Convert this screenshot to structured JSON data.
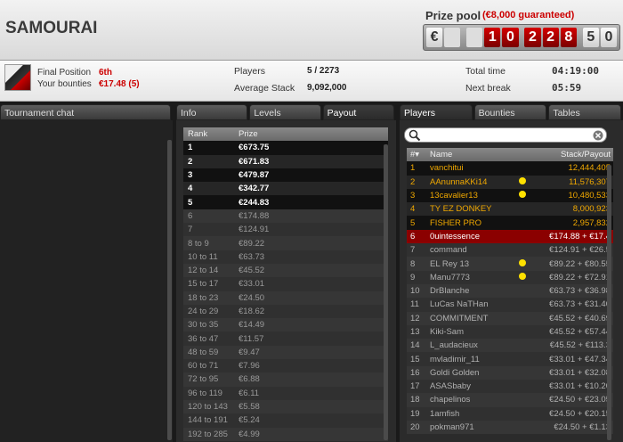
{
  "title": "SAMOURAI",
  "prize_pool": {
    "label": "Prize pool",
    "guarantee": "(€8,000 guaranteed)",
    "currency": "€",
    "digits": [
      "1",
      "0",
      "2",
      "2",
      "8",
      "5",
      "0"
    ]
  },
  "me": {
    "final_position_label": "Final Position",
    "final_position": "6th",
    "bounties_label": "Your bounties",
    "bounties": "€17.48 (5)"
  },
  "stats": {
    "players_label": "Players",
    "players": "5 / 2273",
    "avg_label": "Average Stack",
    "avg": "9,092,000",
    "time_label": "Total time",
    "time": "04:19:00",
    "break_label": "Next break",
    "break": "05:59"
  },
  "chat": {
    "tab": "Tournament chat"
  },
  "mid_tabs": [
    "Info",
    "Levels",
    "Payout"
  ],
  "right_tabs": [
    "Players",
    "Bounties",
    "Tables"
  ],
  "payout": {
    "headers": [
      "Rank",
      "Prize"
    ],
    "rows": [
      [
        "1",
        "€673.75"
      ],
      [
        "2",
        "€671.83"
      ],
      [
        "3",
        "€479.87"
      ],
      [
        "4",
        "€342.77"
      ],
      [
        "5",
        "€244.83"
      ],
      [
        "6",
        "€174.88"
      ],
      [
        "7",
        "€124.91"
      ],
      [
        "8 to 9",
        "€89.22"
      ],
      [
        "10 to 11",
        "€63.73"
      ],
      [
        "12 to 14",
        "€45.52"
      ],
      [
        "15 to 17",
        "€33.01"
      ],
      [
        "18 to 23",
        "€24.50"
      ],
      [
        "24 to 29",
        "€18.62"
      ],
      [
        "30 to 35",
        "€14.49"
      ],
      [
        "36 to 47",
        "€11.57"
      ],
      [
        "48 to 59",
        "€9.47"
      ],
      [
        "60 to 71",
        "€7.96"
      ],
      [
        "72 to 95",
        "€6.88"
      ],
      [
        "96 to 119",
        "€6.11"
      ],
      [
        "120 to 143",
        "€5.58"
      ],
      [
        "144 to 191",
        "€5.24"
      ],
      [
        "192 to 285",
        "€4.99"
      ]
    ]
  },
  "players": {
    "headers": [
      "#▾",
      "Name",
      "Stack/Payout"
    ],
    "rows": [
      [
        "1",
        "vanchitui",
        "12,444,405",
        ""
      ],
      [
        "2",
        "AAnunnaKKi14",
        "11,576,307",
        "y"
      ],
      [
        "3",
        "13cavalier13",
        "10,480,533",
        "y"
      ],
      [
        "4",
        "TY EZ DONKEY",
        "8,000,923",
        ""
      ],
      [
        "5",
        "FISHER PRO",
        "2,957,832",
        ""
      ],
      [
        "6",
        "0uintessence",
        "€174.88 + €17.4",
        ""
      ],
      [
        "7",
        "command",
        "€124.91 + €26.5",
        ""
      ],
      [
        "8",
        "EL Rey 13",
        "€89.22 + €80.55",
        "y"
      ],
      [
        "9",
        "Manu7773",
        "€89.22 + €72.91",
        "y"
      ],
      [
        "10",
        "DrBlanche",
        "€63.73 + €36.98",
        ""
      ],
      [
        "11",
        "LuCas NaTHan",
        "€63.73 + €31.40",
        ""
      ],
      [
        "12",
        "COMMITMENT",
        "€45.52 + €40.69",
        ""
      ],
      [
        "13",
        "Kiki-Sam",
        "€45.52 + €57.44",
        ""
      ],
      [
        "14",
        "L_audacieux",
        "€45.52 + €113.3",
        ""
      ],
      [
        "15",
        "mvladimir_11",
        "€33.01 + €47.34",
        ""
      ],
      [
        "16",
        "Goldi Golden",
        "€33.01 + €32.08",
        ""
      ],
      [
        "17",
        "ASASbaby",
        "€33.01 + €10.20",
        ""
      ],
      [
        "18",
        "chapelinos",
        "€24.50 + €23.05",
        ""
      ],
      [
        "19",
        "1amfish",
        "€24.50 + €20.15",
        ""
      ],
      [
        "20",
        "pokman971",
        "€24.50 + €1.13",
        ""
      ]
    ]
  }
}
